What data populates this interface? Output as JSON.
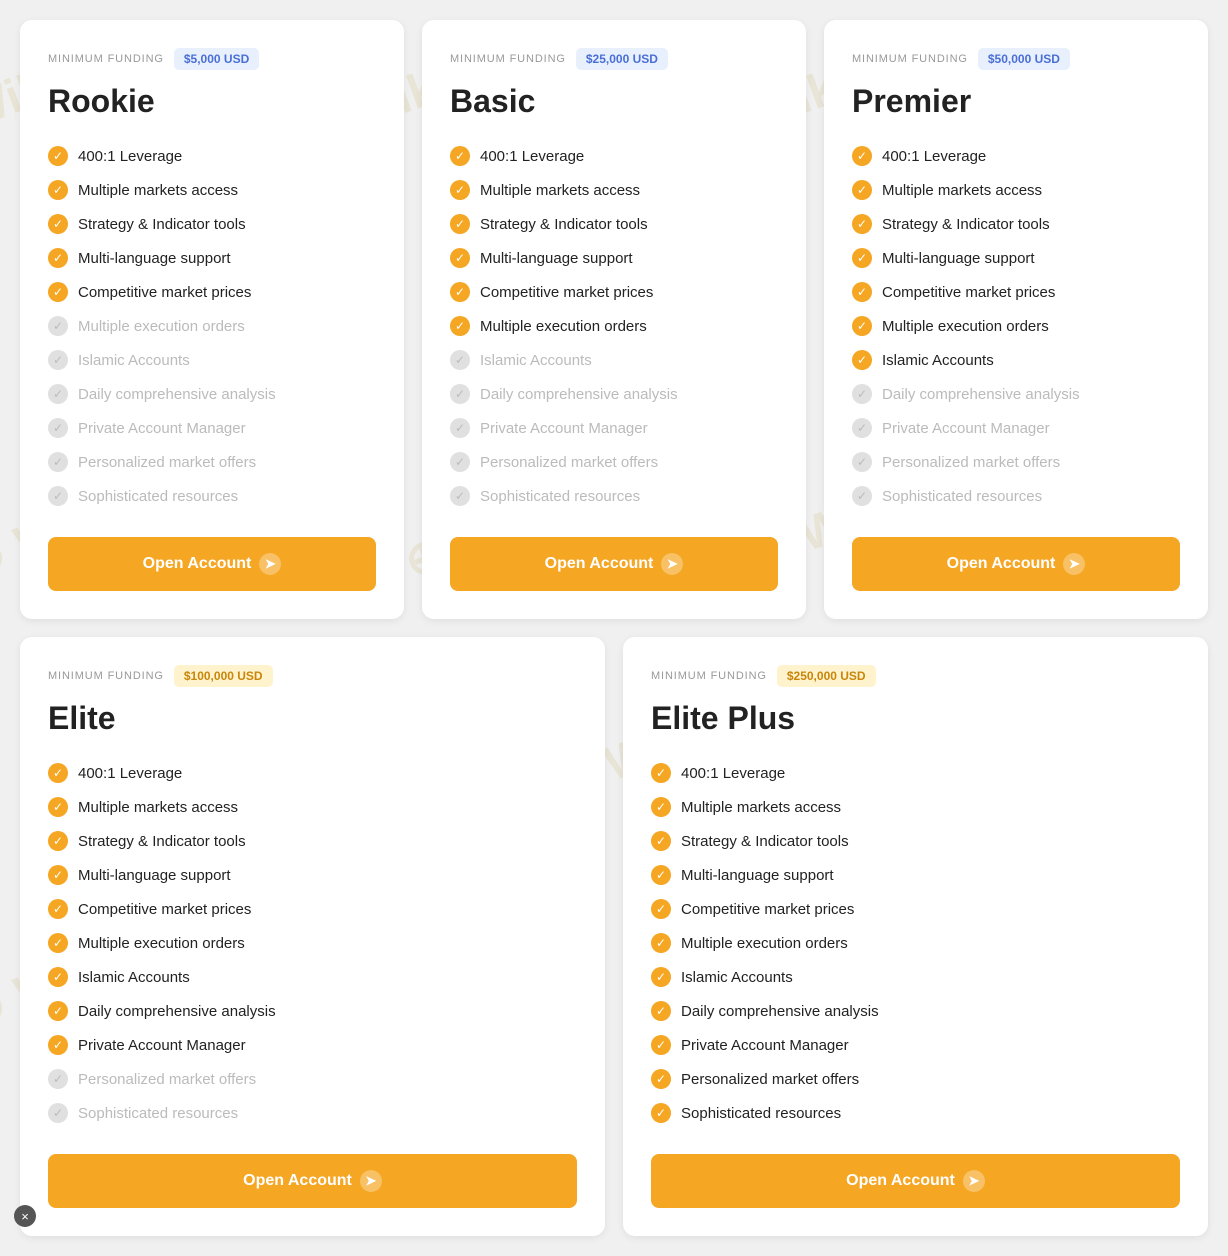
{
  "watermark": {
    "text": "WikiFX"
  },
  "cards": [
    {
      "id": "rookie",
      "title": "Rookie",
      "minFundingLabel": "MINIMUM FUNDING",
      "minFundingValue": "$5,000 USD",
      "badgeType": "blue",
      "features": [
        {
          "label": "400:1 Leverage",
          "active": true
        },
        {
          "label": "Multiple markets access",
          "active": true
        },
        {
          "label": "Strategy & Indicator tools",
          "active": true
        },
        {
          "label": "Multi-language support",
          "active": true
        },
        {
          "label": "Competitive market prices",
          "active": true
        },
        {
          "label": "Multiple execution orders",
          "active": false
        },
        {
          "label": "Islamic Accounts",
          "active": false
        },
        {
          "label": "Daily comprehensive analysis",
          "active": false
        },
        {
          "label": "Private Account Manager",
          "active": false
        },
        {
          "label": "Personalized market offers",
          "active": false
        },
        {
          "label": "Sophisticated resources",
          "active": false
        }
      ],
      "btnLabel": "Open Account"
    },
    {
      "id": "basic",
      "title": "Basic",
      "minFundingLabel": "MINIMUM FUNDING",
      "minFundingValue": "$25,000 USD",
      "badgeType": "blue",
      "features": [
        {
          "label": "400:1 Leverage",
          "active": true
        },
        {
          "label": "Multiple markets access",
          "active": true
        },
        {
          "label": "Strategy & Indicator tools",
          "active": true
        },
        {
          "label": "Multi-language support",
          "active": true
        },
        {
          "label": "Competitive market prices",
          "active": true
        },
        {
          "label": "Multiple execution orders",
          "active": true
        },
        {
          "label": "Islamic Accounts",
          "active": false
        },
        {
          "label": "Daily comprehensive analysis",
          "active": false
        },
        {
          "label": "Private Account Manager",
          "active": false
        },
        {
          "label": "Personalized market offers",
          "active": false
        },
        {
          "label": "Sophisticated resources",
          "active": false
        }
      ],
      "btnLabel": "Open Account"
    },
    {
      "id": "premier",
      "title": "Premier",
      "minFundingLabel": "MINIMUM FUNDING",
      "minFundingValue": "$50,000 USD",
      "badgeType": "blue",
      "features": [
        {
          "label": "400:1 Leverage",
          "active": true
        },
        {
          "label": "Multiple markets access",
          "active": true
        },
        {
          "label": "Strategy & Indicator tools",
          "active": true
        },
        {
          "label": "Multi-language support",
          "active": true
        },
        {
          "label": "Competitive market prices",
          "active": true
        },
        {
          "label": "Multiple execution orders",
          "active": true
        },
        {
          "label": "Islamic Accounts",
          "active": true
        },
        {
          "label": "Daily comprehensive analysis",
          "active": false
        },
        {
          "label": "Private Account Manager",
          "active": false
        },
        {
          "label": "Personalized market offers",
          "active": false
        },
        {
          "label": "Sophisticated resources",
          "active": false
        }
      ],
      "btnLabel": "Open Account"
    },
    {
      "id": "elite",
      "title": "Elite",
      "minFundingLabel": "MINIMUM FUNDING",
      "minFundingValue": "$100,000 USD",
      "badgeType": "gold",
      "features": [
        {
          "label": "400:1 Leverage",
          "active": true
        },
        {
          "label": "Multiple markets access",
          "active": true
        },
        {
          "label": "Strategy & Indicator tools",
          "active": true
        },
        {
          "label": "Multi-language support",
          "active": true
        },
        {
          "label": "Competitive market prices",
          "active": true
        },
        {
          "label": "Multiple execution orders",
          "active": true
        },
        {
          "label": "Islamic Accounts",
          "active": true
        },
        {
          "label": "Daily comprehensive analysis",
          "active": true
        },
        {
          "label": "Private Account Manager",
          "active": true
        },
        {
          "label": "Personalized market offers",
          "active": false
        },
        {
          "label": "Sophisticated resources",
          "active": false
        }
      ],
      "btnLabel": "Open Account"
    },
    {
      "id": "elite-plus",
      "title": "Elite Plus",
      "minFundingLabel": "MINIMUM FUNDING",
      "minFundingValue": "$250,000 USD",
      "badgeType": "gold",
      "features": [
        {
          "label": "400:1 Leverage",
          "active": true
        },
        {
          "label": "Multiple markets access",
          "active": true
        },
        {
          "label": "Strategy & Indicator tools",
          "active": true
        },
        {
          "label": "Multi-language support",
          "active": true
        },
        {
          "label": "Competitive market prices",
          "active": true
        },
        {
          "label": "Multiple execution orders",
          "active": true
        },
        {
          "label": "Islamic Accounts",
          "active": true
        },
        {
          "label": "Daily comprehensive analysis",
          "active": true
        },
        {
          "label": "Private Account Manager",
          "active": true
        },
        {
          "label": "Personalized market offers",
          "active": true
        },
        {
          "label": "Sophisticated resources",
          "active": true
        }
      ],
      "btnLabel": "Open Account"
    }
  ],
  "closeBtn": "×"
}
